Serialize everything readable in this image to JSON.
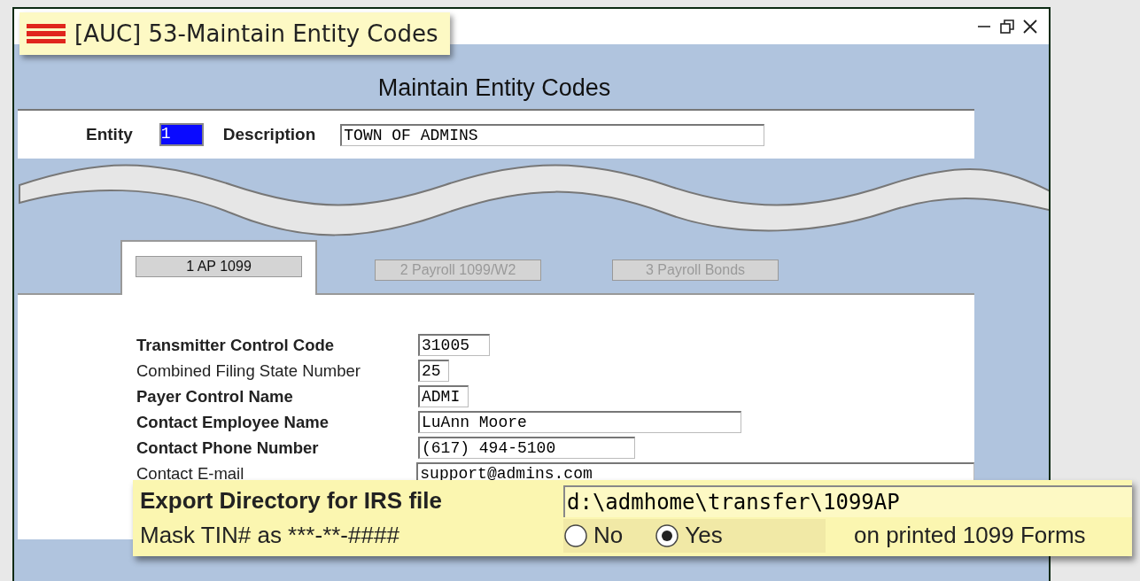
{
  "window": {
    "title": "[AUC] 53-Maintain Entity Codes"
  },
  "heading": "Maintain Entity Codes",
  "entity": {
    "label": "Entity",
    "value": "1",
    "selected": true
  },
  "description": {
    "label": "Description",
    "value": "TOWN OF ADMINS"
  },
  "tabs": [
    {
      "label": "1 AP 1099",
      "selected": true
    },
    {
      "label": "2 Payroll 1099/W2",
      "selected": false
    },
    {
      "label": "3 Payroll Bonds",
      "selected": false
    }
  ],
  "fields": [
    {
      "label": "Transmitter Control Code",
      "value": "31005",
      "bold": true
    },
    {
      "label": "Combined Filing State Number",
      "value": "25",
      "bold": false
    },
    {
      "label": "Payer Control Name",
      "value": "ADMI",
      "bold": true
    },
    {
      "label": "Contact Employee Name",
      "value": "LuAnn Moore",
      "bold": true
    },
    {
      "label": "Contact Phone Number",
      "value": "(617) 494-5100",
      "bold": true
    },
    {
      "label": "Contact E-mail",
      "value": "support@admins.com",
      "bold": false
    }
  ],
  "callout": {
    "export_label": "Export Directory for IRS file",
    "export_value": "d:\\admhome\\transfer\\1099AP",
    "mask_label": "Mask TIN# as ***-**-####",
    "mask_options": [
      {
        "label": "No",
        "selected": false
      },
      {
        "label": "Yes",
        "selected": true
      }
    ],
    "mask_note": "on printed 1099 Forms"
  }
}
